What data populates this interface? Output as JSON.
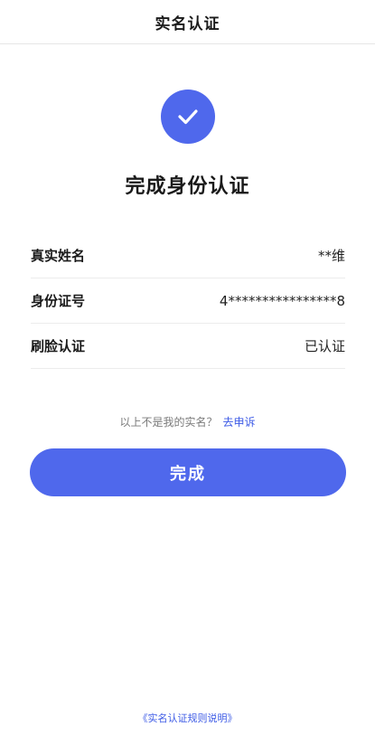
{
  "header": {
    "title": "实名认证"
  },
  "status": {
    "headline": "完成身份认证",
    "icon": "check-icon"
  },
  "info": [
    {
      "label": "真实姓名",
      "value": "**维"
    },
    {
      "label": "身份证号",
      "value": "4****************8"
    },
    {
      "label": "刷脸认证",
      "value": "已认证"
    }
  ],
  "appeal": {
    "text": "以上不是我的实名？",
    "link": "去申诉"
  },
  "actions": {
    "done_label": "完成"
  },
  "footer": {
    "rules_link": "《实名认证规则说明》"
  },
  "colors": {
    "accent": "#4f68ec",
    "link": "#3d5be6"
  }
}
